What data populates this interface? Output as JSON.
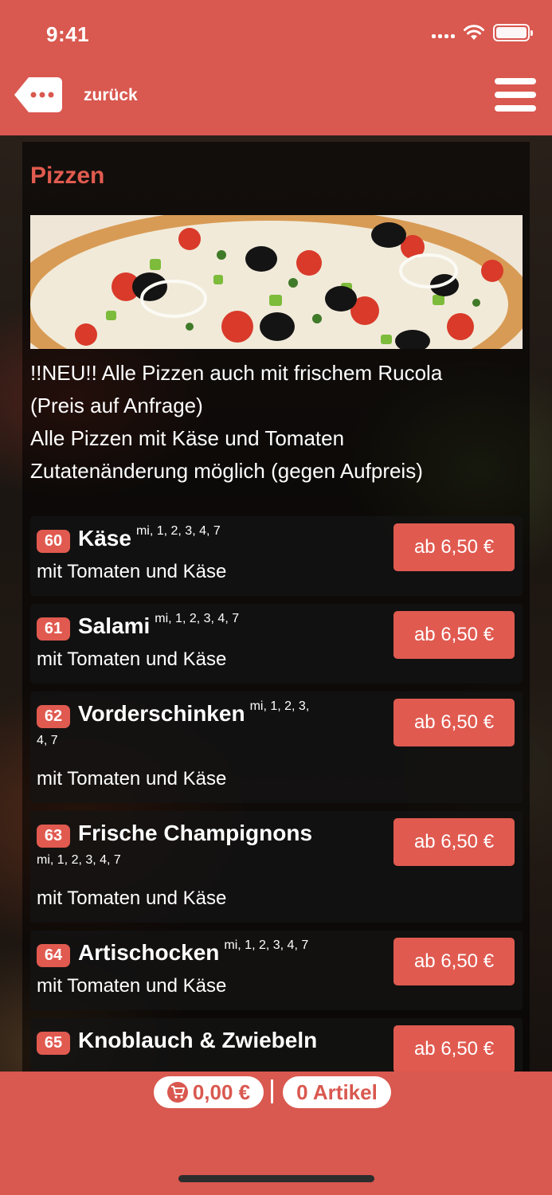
{
  "status_bar": {
    "time": "9:41"
  },
  "header": {
    "back_label": "zurück"
  },
  "section": {
    "title": "Pizzen",
    "intro_lines": [
      "!!NEU!! Alle Pizzen auch mit frischem Rucola",
      "(Preis auf Anfrage)",
      "Alle Pizzen mit Käse und Tomaten",
      "Zutatenänderung möglich (gegen Aufpreis)"
    ]
  },
  "items": [
    {
      "number": "60",
      "name": "Käse",
      "allergens": "mi, 1, 2, 3, 4, 7",
      "description": "mit Tomaten und Käse",
      "price": "ab 6,50 €"
    },
    {
      "number": "61",
      "name": "Salami",
      "allergens": "mi, 1, 2, 3, 4, 7",
      "description": "mit Tomaten und Käse",
      "price": "ab 6,50 €"
    },
    {
      "number": "62",
      "name": "Vorderschinken",
      "allergens_part1": "mi, 1, 2, 3,",
      "allergens_part2": "4, 7",
      "description": "mit Tomaten und Käse",
      "price": "ab 6,50 €"
    },
    {
      "number": "63",
      "name": "Frische Champignons",
      "allergens": "mi, 1, 2, 3, 4, 7",
      "description": "mit Tomaten und Käse",
      "price": "ab 6,50 €"
    },
    {
      "number": "64",
      "name": "Artischocken",
      "allergens": "mi, 1, 2, 3, 4, 7",
      "description": "mit Tomaten und Käse",
      "price": "ab 6,50 €"
    },
    {
      "number": "65",
      "name": "Knoblauch & Zwiebeln",
      "price": "ab 6,50 €"
    }
  ],
  "footer": {
    "cart_total": "0,00 €",
    "item_count": "0 Artikel"
  },
  "colors": {
    "brand": "#d9584f",
    "accent": "#e05a50",
    "panel": "#000000"
  }
}
